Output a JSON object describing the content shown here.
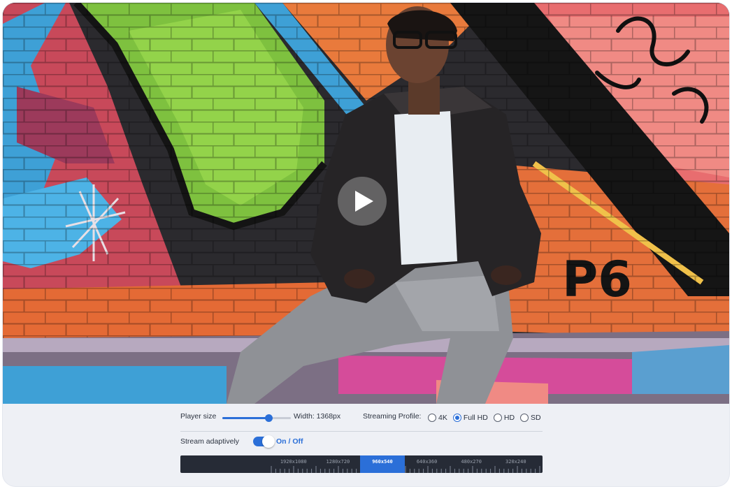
{
  "video": {
    "play_icon": "play-icon",
    "artwork_text": "P6"
  },
  "controls": {
    "player_size": {
      "label": "Player size",
      "value_fraction": 0.67,
      "width_text": "Width: 1368px"
    },
    "streaming_profile": {
      "label": "Streaming Profile:",
      "options": [
        "4K",
        "Full HD",
        "HD",
        "SD"
      ],
      "selected": "Full HD"
    },
    "stream_adaptively": {
      "label": "Stream adaptively",
      "toggle_text": "On / Off",
      "on": true
    },
    "resolutions": {
      "items": [
        "1920x1080",
        "1280x720",
        "960x540",
        "640x360",
        "480x270",
        "320x240"
      ],
      "active": "960x540"
    }
  },
  "colors": {
    "accent": "#2b6fd8",
    "ruler_bg": "#262b36",
    "panel_bg": "#eef0f5"
  }
}
